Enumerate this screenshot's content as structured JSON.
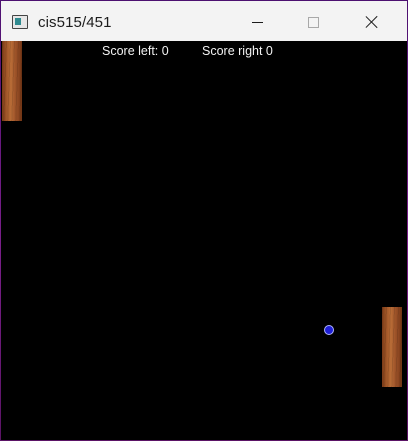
{
  "window": {
    "title": "cis515/451",
    "icon": "app-window-icon",
    "controls": {
      "minimize": "minimize-icon",
      "maximize": "maximize-icon",
      "close": "close-icon"
    }
  },
  "game": {
    "background_color": "#000000",
    "score_left_text": "Score left: 0",
    "score_right_text": "Score right 0",
    "paddle_style": "wood-texture",
    "ball_color": "#1f1fd6"
  }
}
